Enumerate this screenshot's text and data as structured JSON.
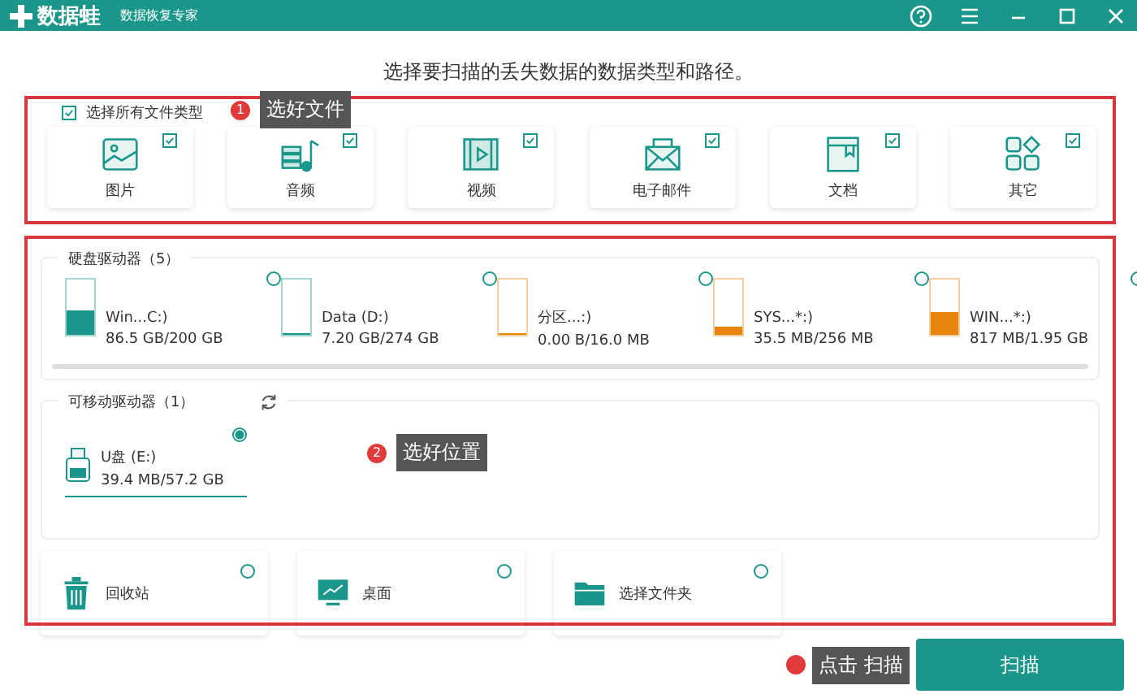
{
  "window": {
    "app_name": "数据蛙",
    "subtitle": "数据恢复专家"
  },
  "heading": "选择要扫描的丢失数据的数据类型和路径。",
  "file_types": {
    "select_all": {
      "label": "选择所有文件类型",
      "checked": true
    },
    "items": [
      {
        "kind": "picture",
        "label": "图片",
        "checked": true
      },
      {
        "kind": "audio",
        "label": "音频",
        "checked": true
      },
      {
        "kind": "video",
        "label": "视频",
        "checked": true
      },
      {
        "kind": "email",
        "label": "电子邮件",
        "checked": true
      },
      {
        "kind": "document",
        "label": "文档",
        "checked": true
      },
      {
        "kind": "other",
        "label": "其它",
        "checked": true
      }
    ]
  },
  "hard_drives": {
    "title": "硬盘驱动器（5）",
    "items": [
      {
        "name": "Win...C:)",
        "usage": "86.5 GB/200 GB",
        "level": 0.43,
        "color": "#1a968a",
        "selected": false
      },
      {
        "name": "Data (D:)",
        "usage": "7.20 GB/274 GB",
        "level": 0.03,
        "color": "#1a968a",
        "selected": false
      },
      {
        "name": "分区...:)",
        "usage": "0.00  B/16.0 MB",
        "level": 0,
        "color": "#e8850c",
        "selected": false
      },
      {
        "name": "SYS...*:)",
        "usage": "35.5 MB/256 MB",
        "level": 0.14,
        "color": "#e8850c",
        "selected": false
      },
      {
        "name": "WIN...*:)",
        "usage": "817 MB/1.95 GB",
        "level": 0.42,
        "color": "#e8850c",
        "selected": false
      }
    ]
  },
  "removable_drives": {
    "title": "可移动驱动器（1）",
    "items": [
      {
        "name": "U盘 (E:)",
        "usage": "39.4 MB/57.2 GB",
        "selected": true
      }
    ]
  },
  "locations": [
    {
      "kind": "recycle",
      "label": "回收站",
      "selected": false
    },
    {
      "kind": "desktop",
      "label": "桌面",
      "selected": false
    },
    {
      "kind": "folder",
      "label": "选择文件夹",
      "selected": false
    }
  ],
  "annotations": [
    {
      "number": "1",
      "text": "选好文件"
    },
    {
      "number": "2",
      "text": "选好位置"
    },
    {
      "text": "点击 扫描"
    }
  ],
  "scan_button": "扫描"
}
